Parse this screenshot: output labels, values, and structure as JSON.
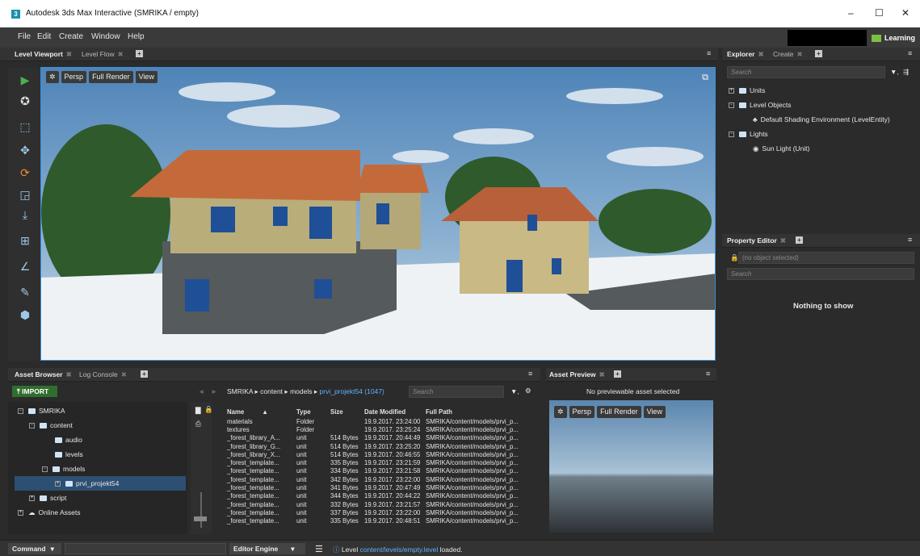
{
  "window": {
    "app_icon": "3",
    "title": "Autodesk 3ds Max Interactive (SMRIKA / empty)",
    "minimize": "–",
    "maximize": "☐",
    "close": "✕"
  },
  "menu": [
    "File",
    "Edit",
    "Create",
    "Window",
    "Help"
  ],
  "learning_label": "Learning",
  "viewport_tabs": {
    "tab1": "Level Viewport",
    "tab2": "Level Flow"
  },
  "viewport_bar": {
    "persp": "Persp",
    "render": "Full Render",
    "view": "View"
  },
  "explorer": {
    "tab1": "Explorer",
    "tab2": "Create",
    "search_placeholder": "Search",
    "tree": [
      {
        "label": "Units",
        "sign": "+"
      },
      {
        "label": "Level Objects",
        "sign": "-"
      },
      {
        "label": "Default Shading Environment (LevelEntity)",
        "sign": ""
      },
      {
        "label": "Lights",
        "sign": "-"
      },
      {
        "label": "Sun Light (Unit)",
        "sign": ""
      }
    ]
  },
  "property_editor": {
    "tab": "Property Editor",
    "no_object": "(no object selected)",
    "search_placeholder": "Search",
    "empty": "Nothing to show"
  },
  "asset_browser": {
    "tab1": "Asset Browser",
    "tab2": "Log Console",
    "import_label": "IMPORT",
    "tree": [
      {
        "label": "SMRIKA"
      },
      {
        "label": "content"
      },
      {
        "label": "audio"
      },
      {
        "label": "levels"
      },
      {
        "label": "models"
      },
      {
        "label": "prvi_projekt54"
      },
      {
        "label": "script"
      },
      {
        "label": "Online Assets"
      }
    ],
    "breadcrumb": {
      "p1": "SMRIKA",
      "p2": "content",
      "p3": "models",
      "current": "prvi_projekt54 (1047)",
      "sep": "▸"
    },
    "search_placeholder": "Search",
    "columns": {
      "name": "Name",
      "type": "Type",
      "size": "Size",
      "date": "Date Modified",
      "path": "Full Path"
    },
    "rows": [
      {
        "name": "materials",
        "type": "Folder",
        "size": "",
        "date": "19.9.2017. 23:24:00",
        "path": "SMRIKA/content/models/prvi_p..."
      },
      {
        "name": "textures",
        "type": "Folder",
        "size": "",
        "date": "19.9.2017. 23:25:24",
        "path": "SMRIKA/content/models/prvi_p..."
      },
      {
        "name": "_forest_library_A...",
        "type": "unit",
        "size": "514 Bytes",
        "date": "19.9.2017. 20:44:49",
        "path": "SMRIKA/content/models/prvi_p..."
      },
      {
        "name": "_forest_library_G...",
        "type": "unit",
        "size": "514 Bytes",
        "date": "19.9.2017. 23:25:20",
        "path": "SMRIKA/content/models/prvi_p..."
      },
      {
        "name": "_forest_library_X...",
        "type": "unit",
        "size": "514 Bytes",
        "date": "19.9.2017. 20:46:55",
        "path": "SMRIKA/content/models/prvi_p..."
      },
      {
        "name": "_forest_template...",
        "type": "unit",
        "size": "335 Bytes",
        "date": "19.9.2017. 23:21:59",
        "path": "SMRIKA/content/models/prvi_p..."
      },
      {
        "name": "_forest_template...",
        "type": "unit",
        "size": "334 Bytes",
        "date": "19.9.2017. 23:21:58",
        "path": "SMRIKA/content/models/prvi_p..."
      },
      {
        "name": "_forest_template...",
        "type": "unit",
        "size": "342 Bytes",
        "date": "19.9.2017. 23:22:00",
        "path": "SMRIKA/content/models/prvi_p..."
      },
      {
        "name": "_forest_template...",
        "type": "unit",
        "size": "341 Bytes",
        "date": "19.9.2017. 20:47:49",
        "path": "SMRIKA/content/models/prvi_p..."
      },
      {
        "name": "_forest_template...",
        "type": "unit",
        "size": "344 Bytes",
        "date": "19.9.2017. 20:44:22",
        "path": "SMRIKA/content/models/prvi_p..."
      },
      {
        "name": "_forest_template...",
        "type": "unit",
        "size": "332 Bytes",
        "date": "19.9.2017. 23:21:57",
        "path": "SMRIKA/content/models/prvi_p..."
      },
      {
        "name": "_forest_template...",
        "type": "unit",
        "size": "337 Bytes",
        "date": "19.9.2017. 23:22:00",
        "path": "SMRIKA/content/models/prvi_p..."
      },
      {
        "name": "_forest_template...",
        "type": "unit",
        "size": "335 Bytes",
        "date": "19.9.2017. 20:48:51",
        "path": "SMRIKA/content/models/prvi_p..."
      }
    ]
  },
  "asset_preview": {
    "tab": "Asset Preview",
    "message": "No previewable asset selected",
    "persp": "Persp",
    "render": "Full Render",
    "view": "View"
  },
  "status": {
    "command": "Command",
    "engine": "Editor Engine",
    "msg_prefix": "Level",
    "msg_link": "content/levels/empty.level",
    "msg_suffix": "loaded."
  },
  "colors": {
    "accent": "#3a8fd8",
    "link": "#5fb2ff",
    "learning": "#7bc043",
    "play": "#4caf50"
  }
}
